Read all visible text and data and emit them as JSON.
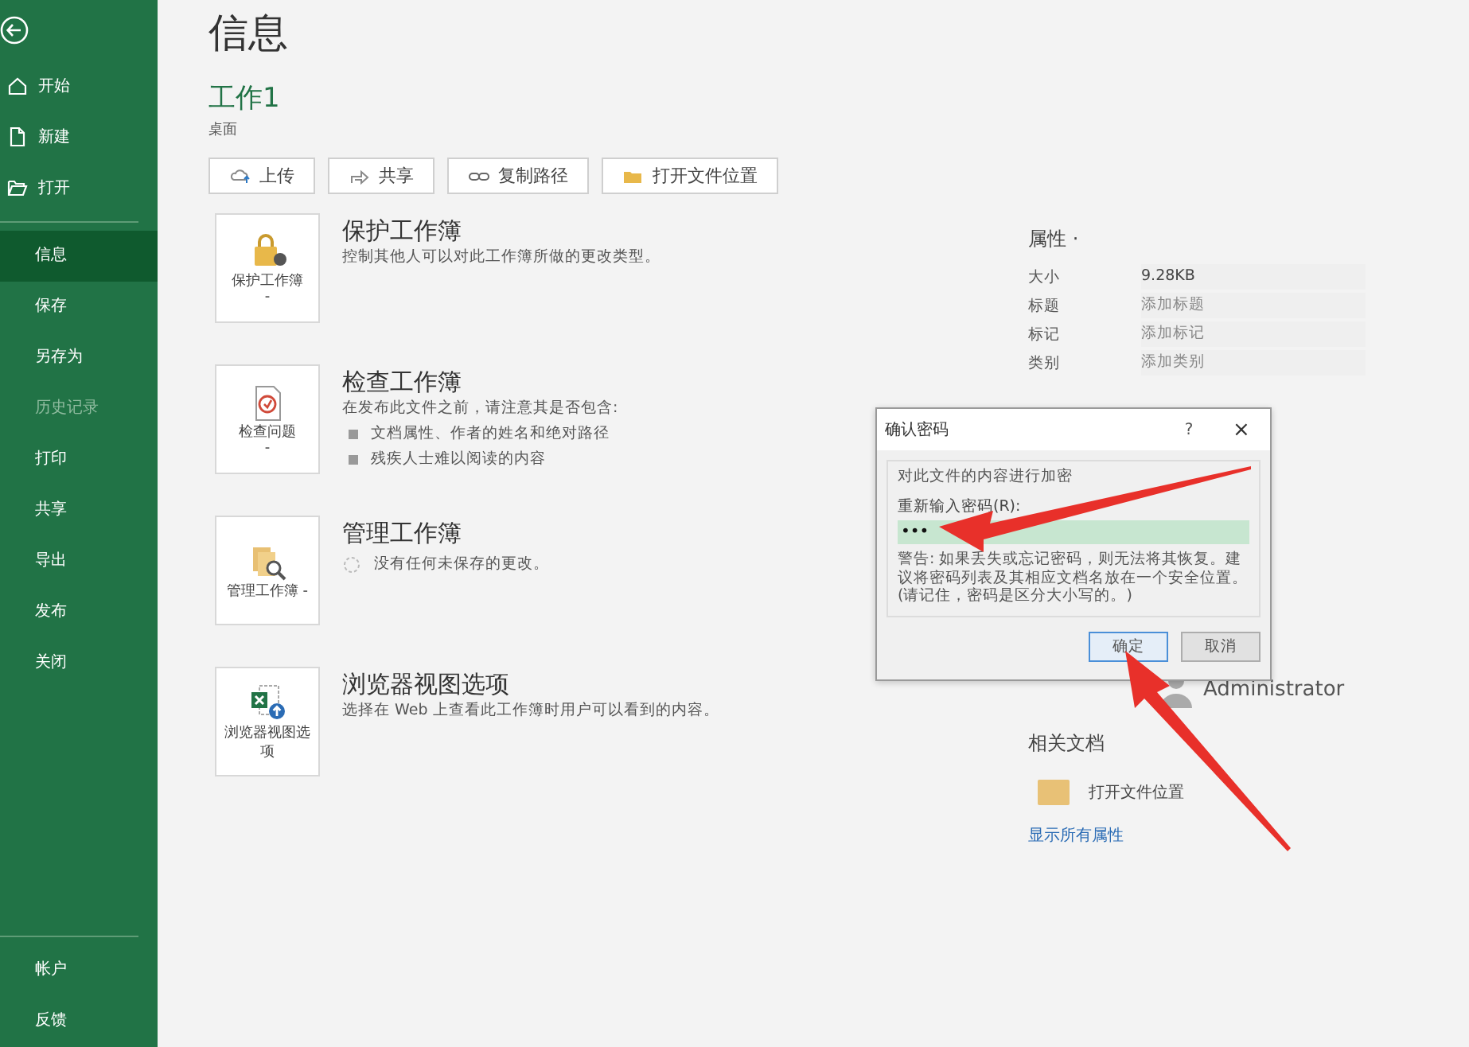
{
  "sidebar": {
    "top_items": [
      {
        "label": "开始"
      },
      {
        "label": "新建"
      },
      {
        "label": "打开"
      }
    ],
    "items": [
      {
        "label": "信息",
        "selected": true,
        "disabled": false
      },
      {
        "label": "保存",
        "selected": false,
        "disabled": false
      },
      {
        "label": "另存为",
        "selected": false,
        "disabled": false
      },
      {
        "label": "历史记录",
        "selected": false,
        "disabled": true
      },
      {
        "label": "打印",
        "selected": false,
        "disabled": false
      },
      {
        "label": "共享",
        "selected": false,
        "disabled": false
      },
      {
        "label": "导出",
        "selected": false,
        "disabled": false
      },
      {
        "label": "发布",
        "selected": false,
        "disabled": false
      },
      {
        "label": "关闭",
        "selected": false,
        "disabled": false
      }
    ],
    "bottom_items": [
      {
        "label": "帐户"
      },
      {
        "label": "反馈"
      }
    ]
  },
  "page_title": "信息",
  "file": {
    "name": "工作1",
    "location": "桌面"
  },
  "toolbar": [
    "上传",
    "共享",
    "复制路径",
    "打开文件位置"
  ],
  "sections": [
    {
      "card_label": "保护工作簿",
      "card_caret": "-",
      "title": "保护工作簿",
      "description": "控制其他人可以对此工作簿所做的更改类型。"
    },
    {
      "card_label": "检查问题",
      "card_caret": "-",
      "title": "检查工作簿",
      "description": "在发布此文件之前，请注意其是否包含:",
      "bullets": [
        "文档属性、作者的姓名和绝对路径",
        "残疾人士难以阅读的内容"
      ]
    },
    {
      "card_label": "管理工作簿 -",
      "title": "管理工作簿",
      "note": "没有任何未保存的更改。"
    },
    {
      "card_label": "浏览器视图选项",
      "title": "浏览器视图选项",
      "description": "选择在 Web 上查看此工作簿时用户可以看到的内容。"
    }
  ],
  "properties": {
    "title": "属性 ·",
    "rows": [
      {
        "label": "大小",
        "value": "9.28KB"
      },
      {
        "label": "标题",
        "placeholder": "添加标题"
      },
      {
        "label": "标记",
        "placeholder": "添加标记"
      },
      {
        "label": "类别",
        "placeholder": "添加类别"
      }
    ]
  },
  "author": "Administrator",
  "related_docs": {
    "title": "相关文档",
    "items": [
      "打开文件位置"
    ],
    "link": "显示所有属性"
  },
  "dialog": {
    "title": "确认密码",
    "help": "?",
    "close": "×",
    "group": "对此文件的内容进行加密",
    "field_label": "重新输入密码(R):",
    "value": "•••",
    "warning": "警告: 如果丢失或忘记密码，则无法将其恢复。建议将密码列表及其相应文档名放在一个安全位置。(请记住，密码是区分大小写的。)",
    "buttons": [
      {
        "label": "确定",
        "selected": true
      },
      {
        "label": "取消",
        "selected": false
      }
    ]
  }
}
